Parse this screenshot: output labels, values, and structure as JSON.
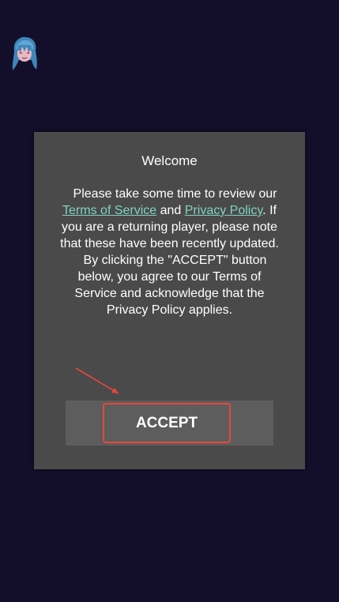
{
  "dialog": {
    "title": "Welcome",
    "p1_prefix": "Please take some time to review our ",
    "terms_link": "Terms of Service",
    "and": " and ",
    "privacy_link": "Privacy Policy",
    "p1_suffix": ". If you are a returning player, please note that these have been recently updated.",
    "p2": "By clicking the \"ACCEPT\" button below, you agree to our Terms of Service and acknowledge that the Privacy Policy applies.",
    "accept_label": "ACCEPT"
  },
  "colors": {
    "background": "#130f2b",
    "dialog": "#4a4a4a",
    "link": "#7fd3bf",
    "highlight": "#e8473b"
  },
  "icons": {
    "avatar": "character-avatar-icon",
    "arrow": "annotation-arrow-icon"
  }
}
